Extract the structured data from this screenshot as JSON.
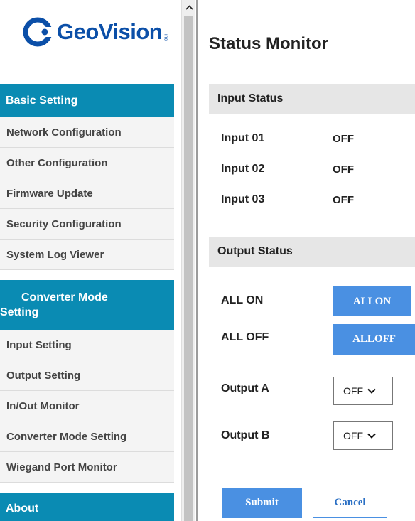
{
  "logo": {
    "brand": "GeoVision",
    "suffix": "inc"
  },
  "sidebar": {
    "basic_header": "Basic Setting",
    "basic_items": [
      "Network Configuration",
      "Other Configuration",
      "Firmware Update",
      "Security Configuration",
      "System Log Viewer"
    ],
    "converter_header_line1": "Converter Mode",
    "converter_header_line2": "Setting",
    "converter_items": [
      "Input Setting",
      "Output Setting",
      "In/Out Monitor",
      "Converter Mode Setting",
      "Wiegand Port Monitor"
    ],
    "about_header": "About"
  },
  "main": {
    "title": "Status Monitor",
    "input_status": {
      "header": "Input Status",
      "rows": [
        {
          "label": "Input 01",
          "value": "OFF"
        },
        {
          "label": "Input 02",
          "value": "OFF"
        },
        {
          "label": "Input 03",
          "value": "OFF"
        }
      ]
    },
    "output_status": {
      "header": "Output Status",
      "all_on_label": "ALL ON",
      "all_on_button": "ALLON",
      "all_off_label": "ALL OFF",
      "all_off_button": "ALLOFF",
      "output_a_label": "Output A",
      "output_a_value": "OFF",
      "output_b_label": "Output B",
      "output_b_value": "OFF"
    },
    "submit_label": "Submit",
    "cancel_label": "Cancel"
  },
  "colors": {
    "menu_header": "#0a8bb3",
    "button_blue": "#4a90e2",
    "section_bg": "#e6e6e6",
    "logo_blue": "#0b4fa8"
  },
  "icons": [
    "geovision-logo-icon",
    "scroll-up-arrow-icon",
    "chevron-down-icon"
  ]
}
